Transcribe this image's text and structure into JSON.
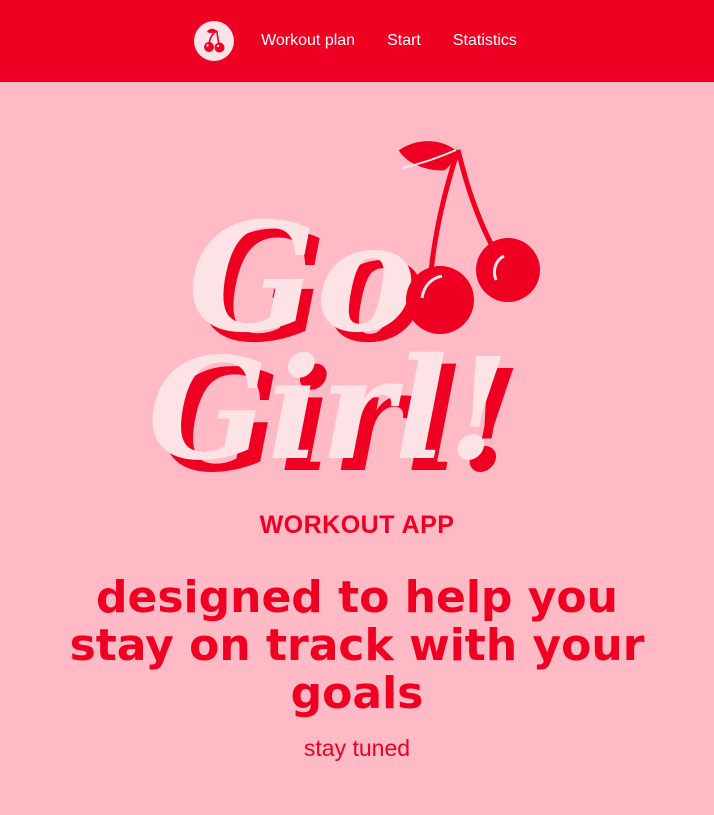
{
  "colors": {
    "accent": "#ef0022",
    "background": "#ffbac6",
    "logo_light": "#fde2e6"
  },
  "nav": {
    "logo_icon": "cherry-icon",
    "links": [
      {
        "label": "Workout plan"
      },
      {
        "label": "Start"
      },
      {
        "label": "Statistics"
      }
    ]
  },
  "hero": {
    "logo_line1": "Go",
    "logo_line2": "Girl!",
    "logo_icon": "cherry-icon",
    "subtitle": "WORKOUT APP",
    "headline": "designed to help you stay on track with your goals",
    "tagline": "stay tuned"
  }
}
